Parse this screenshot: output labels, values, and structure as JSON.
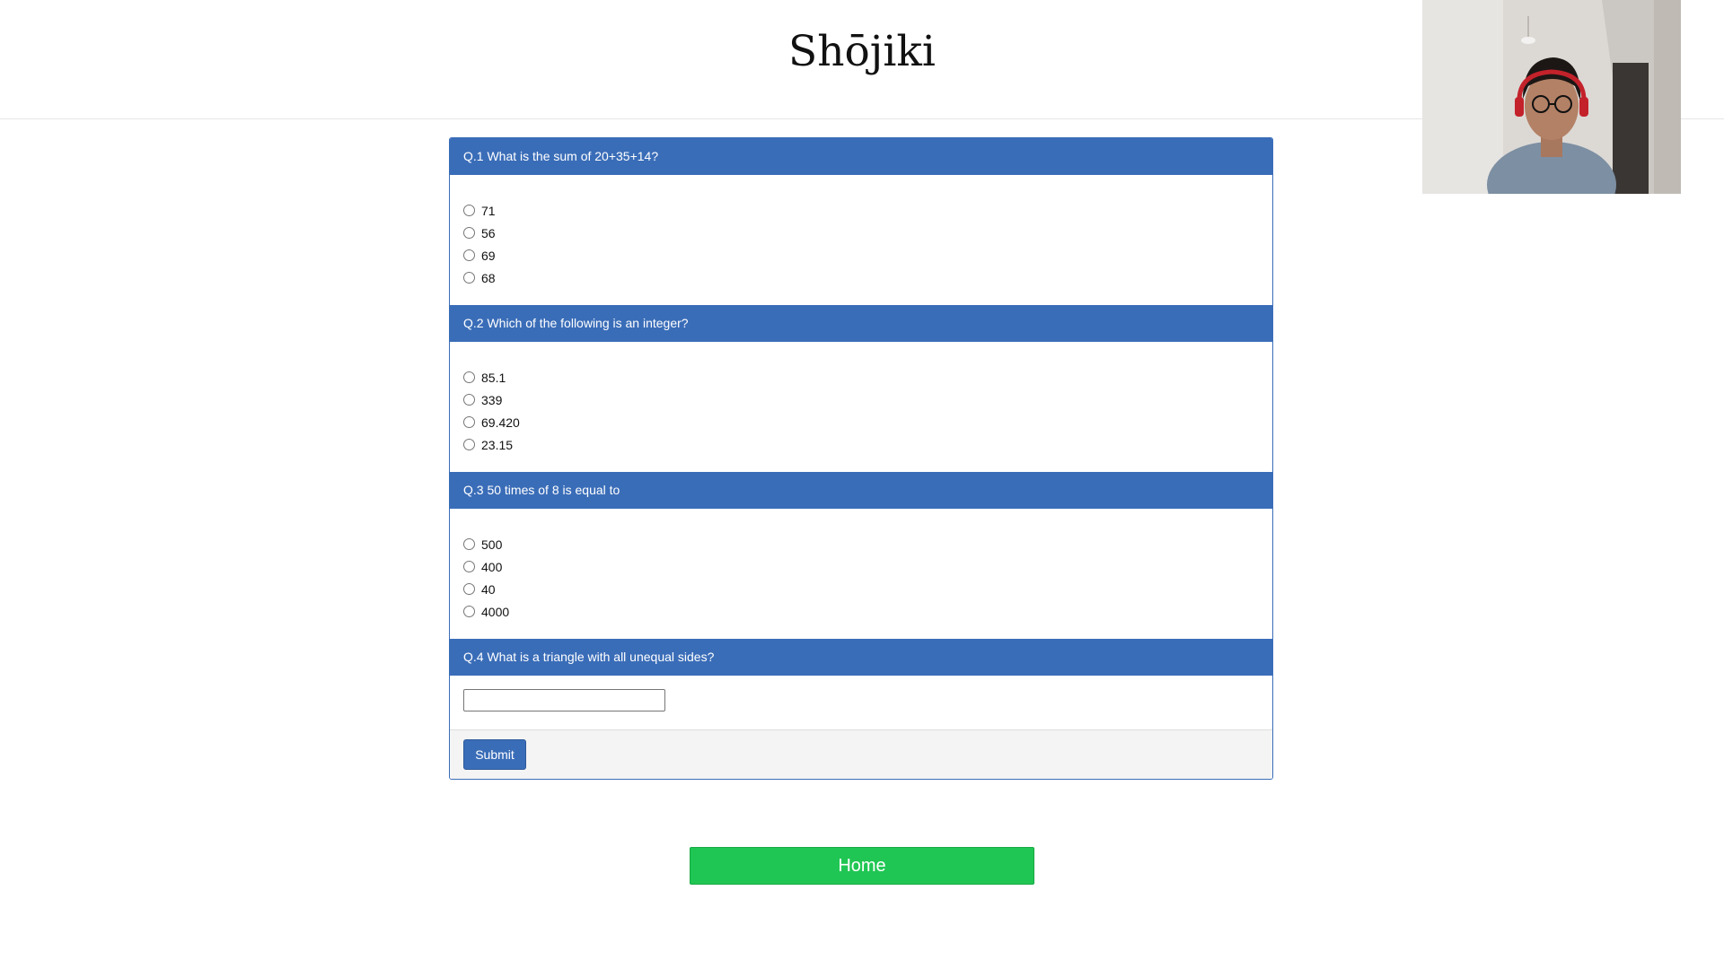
{
  "header": {
    "title": "Shōjiki"
  },
  "quiz": {
    "questions": [
      {
        "label": "Q.1 What is the sum of 20+35+14?",
        "type": "radio",
        "options": [
          "71",
          "56",
          "69",
          "68"
        ]
      },
      {
        "label": "Q.2 Which of the following is an integer?",
        "type": "radio",
        "options": [
          "85.1",
          "339",
          "69.420",
          "23.15"
        ]
      },
      {
        "label": "Q.3 50 times of 8 is equal to",
        "type": "radio",
        "options": [
          "500",
          "400",
          "40",
          "4000"
        ]
      },
      {
        "label": "Q.4 What is a triangle with all unequal sides?",
        "type": "text",
        "value": "",
        "placeholder": ""
      }
    ],
    "submit_label": "Submit"
  },
  "home_label": "Home",
  "colors": {
    "accent": "#3a6db8",
    "home_button": "#20c653",
    "footer_bg": "#f4f4f4"
  }
}
